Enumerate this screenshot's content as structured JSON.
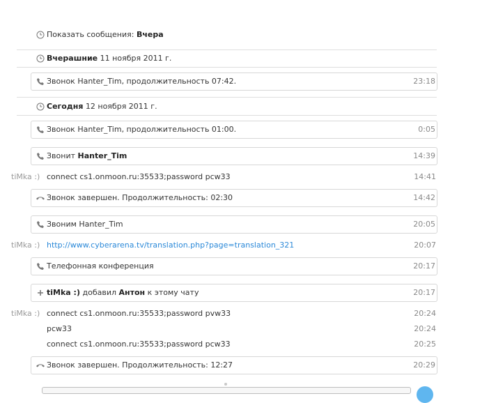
{
  "history_filter": {
    "label": "Показать сообщения:",
    "value": "Вчера"
  },
  "days": {
    "yesterday": {
      "title": "Вчерашние",
      "date": "11 ноября 2011 г."
    },
    "today": {
      "title": "Сегодня",
      "date": "12 ноября 2011 г."
    }
  },
  "events": {
    "call_1": {
      "text": "Звонок Hanter_Tim, продолжительность 07:42.",
      "time": "23:18"
    },
    "call_2": {
      "text": "Звонок Hanter_Tim, продолжительность 01:00.",
      "time": "0:05"
    },
    "incoming": {
      "prefix": "Звонит",
      "name": "Hanter_Tim",
      "time": "14:39"
    },
    "ended_1": {
      "text": "Звонок завершен. Продолжительность: 02:30",
      "time": "14:42"
    },
    "outgoing": {
      "text": "Звоним Hanter_Tim",
      "time": "20:05"
    },
    "conference": {
      "text": "Телефонная конференция",
      "time": "20:17"
    },
    "added": {
      "actor": "tiMka :)",
      "verb": "добавил",
      "person": "Антон",
      "suffix": "к этому чату",
      "time": "20:17"
    },
    "ended_2": {
      "text": "Звонок завершен. Продолжительность: 12:27",
      "time": "20:29"
    }
  },
  "messages": [
    {
      "sender": "tiMka :)",
      "text": "connect cs1.onmoon.ru:35533;password pcw33",
      "time": "14:41"
    },
    {
      "sender": "tiMka :)",
      "text": "http://www.cyberarena.tv/translation.php?page=translation_321",
      "time": "20:07"
    },
    {
      "sender": "tiMka :)",
      "text": "connect cs1.onmoon.ru:35533;password pvw33",
      "time": "20:24"
    },
    {
      "sender": "",
      "text": "pcw33",
      "time": "20:24"
    },
    {
      "sender": "",
      "text": "connect cs1.onmoon.ru:35533;password pcw33",
      "time": "20:25"
    }
  ],
  "colors": {
    "link": "#2a88d8",
    "border": "#d7d7d7",
    "time": "#888888",
    "send_button": "#5fb6ef"
  },
  "icons": {
    "history": "clock-icon",
    "call": "phone-icon",
    "hangup": "hangup-icon",
    "add": "plus-icon"
  }
}
